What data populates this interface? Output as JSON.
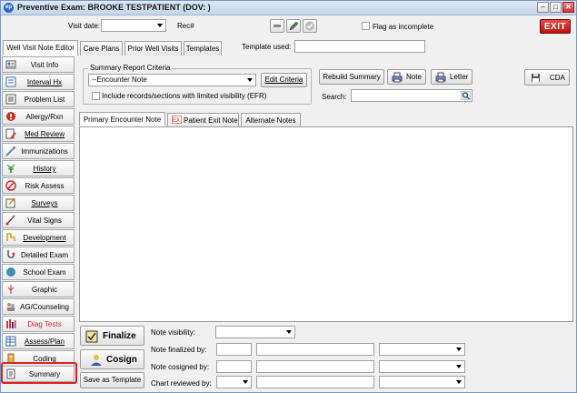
{
  "window": {
    "title": "Preventive Exam: BROOKE TESTPATIENT (DOV: )"
  },
  "header": {
    "visit_date_label": "Visit date:",
    "rec_label": "Rec#",
    "flag_incomplete_label": "Flag as incomplete",
    "exit_label": "EXIT"
  },
  "top_tabs": [
    {
      "label": "Well Visit Note Editor"
    },
    {
      "label": "Care Plans"
    },
    {
      "label": "Prior Well Visits"
    },
    {
      "label": "Templates"
    }
  ],
  "template_used_label": "Template used:",
  "sidebar": {
    "items": [
      {
        "label": "Visit Info",
        "icon": "visit-info-icon"
      },
      {
        "label": "Interval Hx",
        "icon": "interval-hx-icon"
      },
      {
        "label": "Problem List",
        "icon": "problem-list-icon"
      },
      {
        "label": "Allergy/Rxn",
        "icon": "allergy-icon"
      },
      {
        "label": "Med Review",
        "icon": "med-review-icon"
      },
      {
        "label": "Immunizations",
        "icon": "syringe-icon"
      },
      {
        "label": "History",
        "icon": "history-icon"
      },
      {
        "label": "Risk Assess",
        "icon": "risk-assess-icon"
      },
      {
        "label": "Surveys",
        "icon": "survey-icon"
      },
      {
        "label": "Vital Signs",
        "icon": "vital-signs-icon"
      },
      {
        "label": "Development",
        "icon": "development-icon"
      },
      {
        "label": "Detailed Exam",
        "icon": "stethoscope-icon"
      },
      {
        "label": "School Exam",
        "icon": "globe-icon"
      },
      {
        "label": "Graphic",
        "icon": "graphic-icon"
      },
      {
        "label": "AG/Counseling",
        "icon": "counseling-icon"
      },
      {
        "label": "Diag Tests",
        "icon": "diag-tests-icon"
      },
      {
        "label": "Assess/Plan",
        "icon": "assess-plan-icon"
      },
      {
        "label": "Coding",
        "icon": "coding-icon"
      },
      {
        "label": "Summary",
        "icon": "summary-icon"
      }
    ],
    "diag_tests_color": "#e02020"
  },
  "criteria": {
    "group_label": "Summary Report Criteria",
    "dropdown_value": "--Encounter Note",
    "edit_label": "Edit Criteria",
    "include_label": "Include records/sections with limited visibility (EFR)"
  },
  "actions": {
    "rebuild_label": "Rebuild Summary",
    "note_label": "Note",
    "letter_label": "Letter",
    "cda_label": "CDA",
    "search_label": "Search:"
  },
  "note_tabs": [
    {
      "label": "Primary Encounter Note"
    },
    {
      "label": "Patient Exit Note"
    },
    {
      "label": "Alternate Notes"
    }
  ],
  "bottom": {
    "finalize_label": "Finalize",
    "cosign_label": "Cosign",
    "save_template_label": "Save as Template",
    "note_visibility_label": "Note visibility:",
    "note_finalized_label": "Note finalized by:",
    "note_cosigned_label": "Note cosigned by:",
    "chart_reviewed_label": "Chart reviewed by:"
  }
}
